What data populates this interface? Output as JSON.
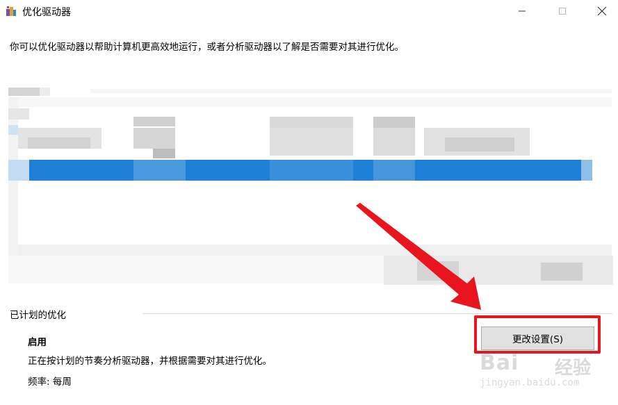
{
  "window": {
    "title": "优化驱动器",
    "icon": "defrag-app-icon"
  },
  "description": "你可以优化驱动器以帮助计算机更高效地运行，或者分析驱动器以了解是否需要对其进行优化。",
  "schedule": {
    "section_title": "已计划的优化",
    "status": "启用",
    "status_description": "正在按计划的节奏分析驱动器，并根据需要对其进行优化。",
    "frequency": "频率: 每周",
    "change_settings_label": "更改设置(S)"
  },
  "watermark": {
    "brand": "Bai",
    "brand_cn": "经验",
    "url": "jingyan.baidu.com"
  },
  "colors": {
    "selection": "#1e7fd6",
    "annotation_red": "#e8141e"
  }
}
